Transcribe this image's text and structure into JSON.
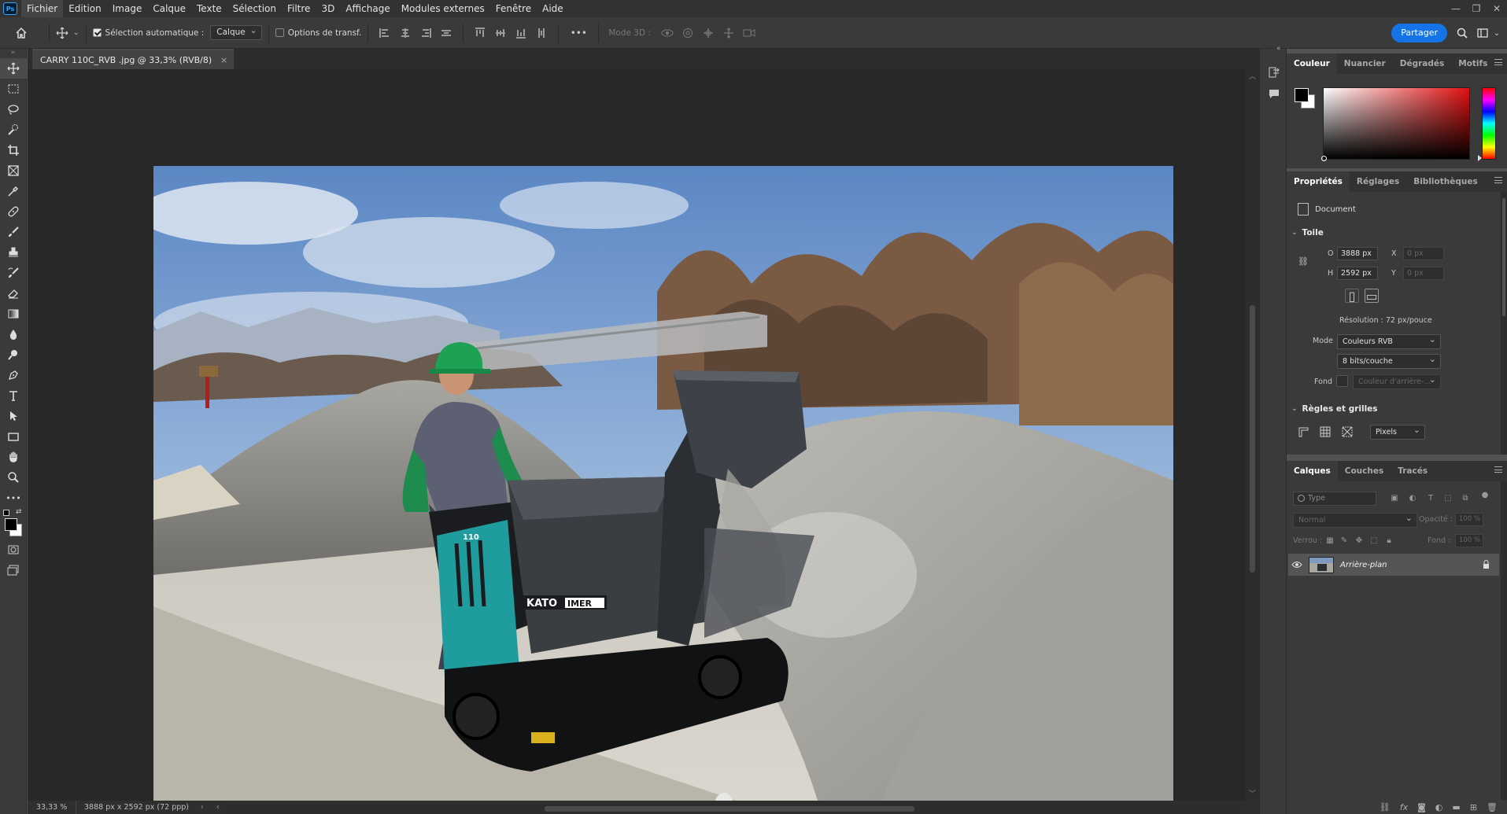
{
  "app": {
    "logo_text": "Ps"
  },
  "menu": [
    "Fichier",
    "Edition",
    "Image",
    "Calque",
    "Texte",
    "Sélection",
    "Filtre",
    "3D",
    "Affichage",
    "Modules externes",
    "Fenêtre",
    "Aide"
  ],
  "window_controls": {
    "minimize": "—",
    "restore": "❐",
    "close": "✕"
  },
  "options": {
    "auto_select_label": "Sélection automatique :",
    "auto_select_checked": true,
    "layer_select_value": "Calque",
    "transform_label": "Options de transf.",
    "transform_checked": false,
    "more_label": "•••",
    "mode3d_label": "Mode 3D :",
    "share_label": "Partager"
  },
  "document": {
    "tab_title": "CARRY 110C_RVB .jpg @ 33,3% (RVB/8)",
    "close_glyph": "×",
    "photo_description_icon": "photo-kato-imer-carry-110-dumper",
    "machine_brand_1": "KATO",
    "machine_brand_2": "IMER",
    "machine_model": "110"
  },
  "status": {
    "zoom": "33,33 %",
    "info": "3888 px x 2592 px (72 ppp)",
    "arrow_right": "›",
    "arrow_left": "‹"
  },
  "color_panel": {
    "tabs": [
      "Couleur",
      "Nuancier",
      "Dégradés",
      "Motifs"
    ],
    "active_tab": 0,
    "foreground": "#000000",
    "background": "#ffffff",
    "hue": "#e01010"
  },
  "properties_panel": {
    "tabs": [
      "Propriétés",
      "Réglages",
      "Bibliothèques"
    ],
    "active_tab": 0,
    "doc_label": "Document",
    "canvas_section": "Toile",
    "width_label": "O",
    "width_value": "3888 px",
    "height_label": "H",
    "height_value": "2592 px",
    "x_label": "X",
    "x_value": "0 px",
    "y_label": "Y",
    "y_value": "0 px",
    "resolution": "Résolution : 72 px/pouce",
    "mode_label": "Mode",
    "mode_value": "Couleurs RVB",
    "bits_value": "8 bits/couche",
    "fill_label": "Fond",
    "fill_value": "Couleur d'arrière-...",
    "rulers_section": "Règles et grilles",
    "units_value": "Pixels"
  },
  "layers_panel": {
    "tabs": [
      "Calques",
      "Couches",
      "Tracés"
    ],
    "active_tab": 0,
    "search_placeholder": "Type",
    "blend_mode": "Normal",
    "opacity_label": "Opacité :",
    "opacity_value": "100 %",
    "lock_label": "Verrou :",
    "fill_label": "Fond :",
    "fill_value": "100 %",
    "layers": [
      {
        "name": "Arrière-plan",
        "visible": true,
        "locked": true
      }
    ]
  }
}
